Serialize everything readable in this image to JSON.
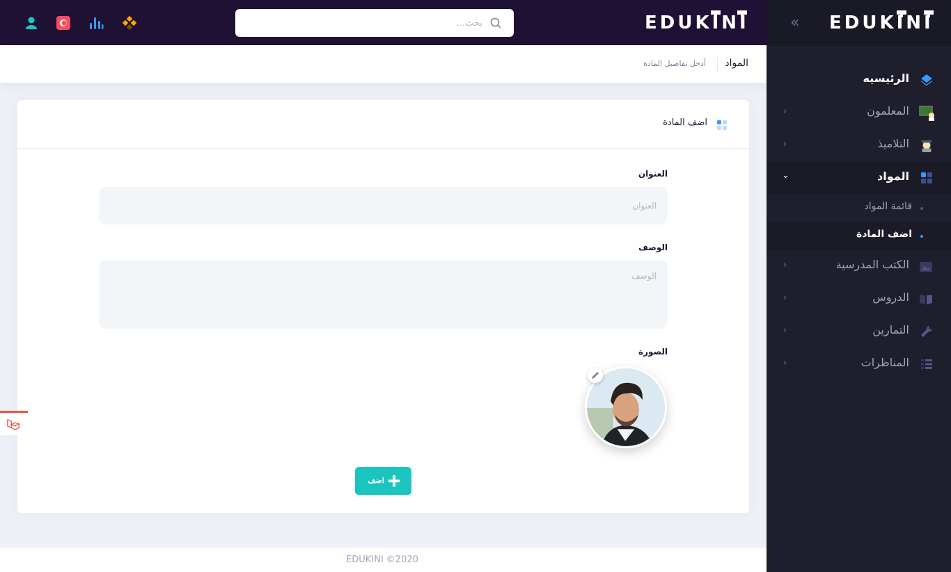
{
  "brand": {
    "logo_text": "EDUKINI"
  },
  "header": {
    "search_placeholder": "بحث...",
    "icons": [
      "user-icon",
      "flag-icon",
      "chart-bars-icon",
      "apps-icon"
    ]
  },
  "sidebar": {
    "items": [
      {
        "label": "الرئيسيه",
        "icon": "layers-icon"
      },
      {
        "label": "المعلمون",
        "icon": "teacher-icon"
      },
      {
        "label": "التلاميذ",
        "icon": "student-icon"
      },
      {
        "label": "المواد",
        "icon": "grid-icon"
      },
      {
        "label": "الكتب المدرسية",
        "icon": "picture-icon"
      },
      {
        "label": "الدروس",
        "icon": "book-icon"
      },
      {
        "label": "التمارين",
        "icon": "wrench-icon"
      },
      {
        "label": "المناظرات",
        "icon": "list-icon"
      }
    ],
    "subitems": [
      {
        "label": "قائمة المواد"
      },
      {
        "label": "اضف المادة"
      }
    ]
  },
  "subheader": {
    "title": "المواد",
    "description": "أدخل تفاصيل المادة"
  },
  "card": {
    "title": "اضف المادة",
    "fields": {
      "title_label": "العنوان",
      "title_placeholder": "العنوان",
      "description_label": "الوصف",
      "description_placeholder": "الوصف",
      "image_label": "الصورة"
    },
    "submit_label": "اضف"
  },
  "footer": {
    "text": "EDUKINI  ©2020"
  },
  "colors": {
    "header_bg": "#1f1133",
    "sidebar_bg": "#1e1e2d",
    "accent": "#3699ff",
    "success": "#1bc5bd"
  }
}
